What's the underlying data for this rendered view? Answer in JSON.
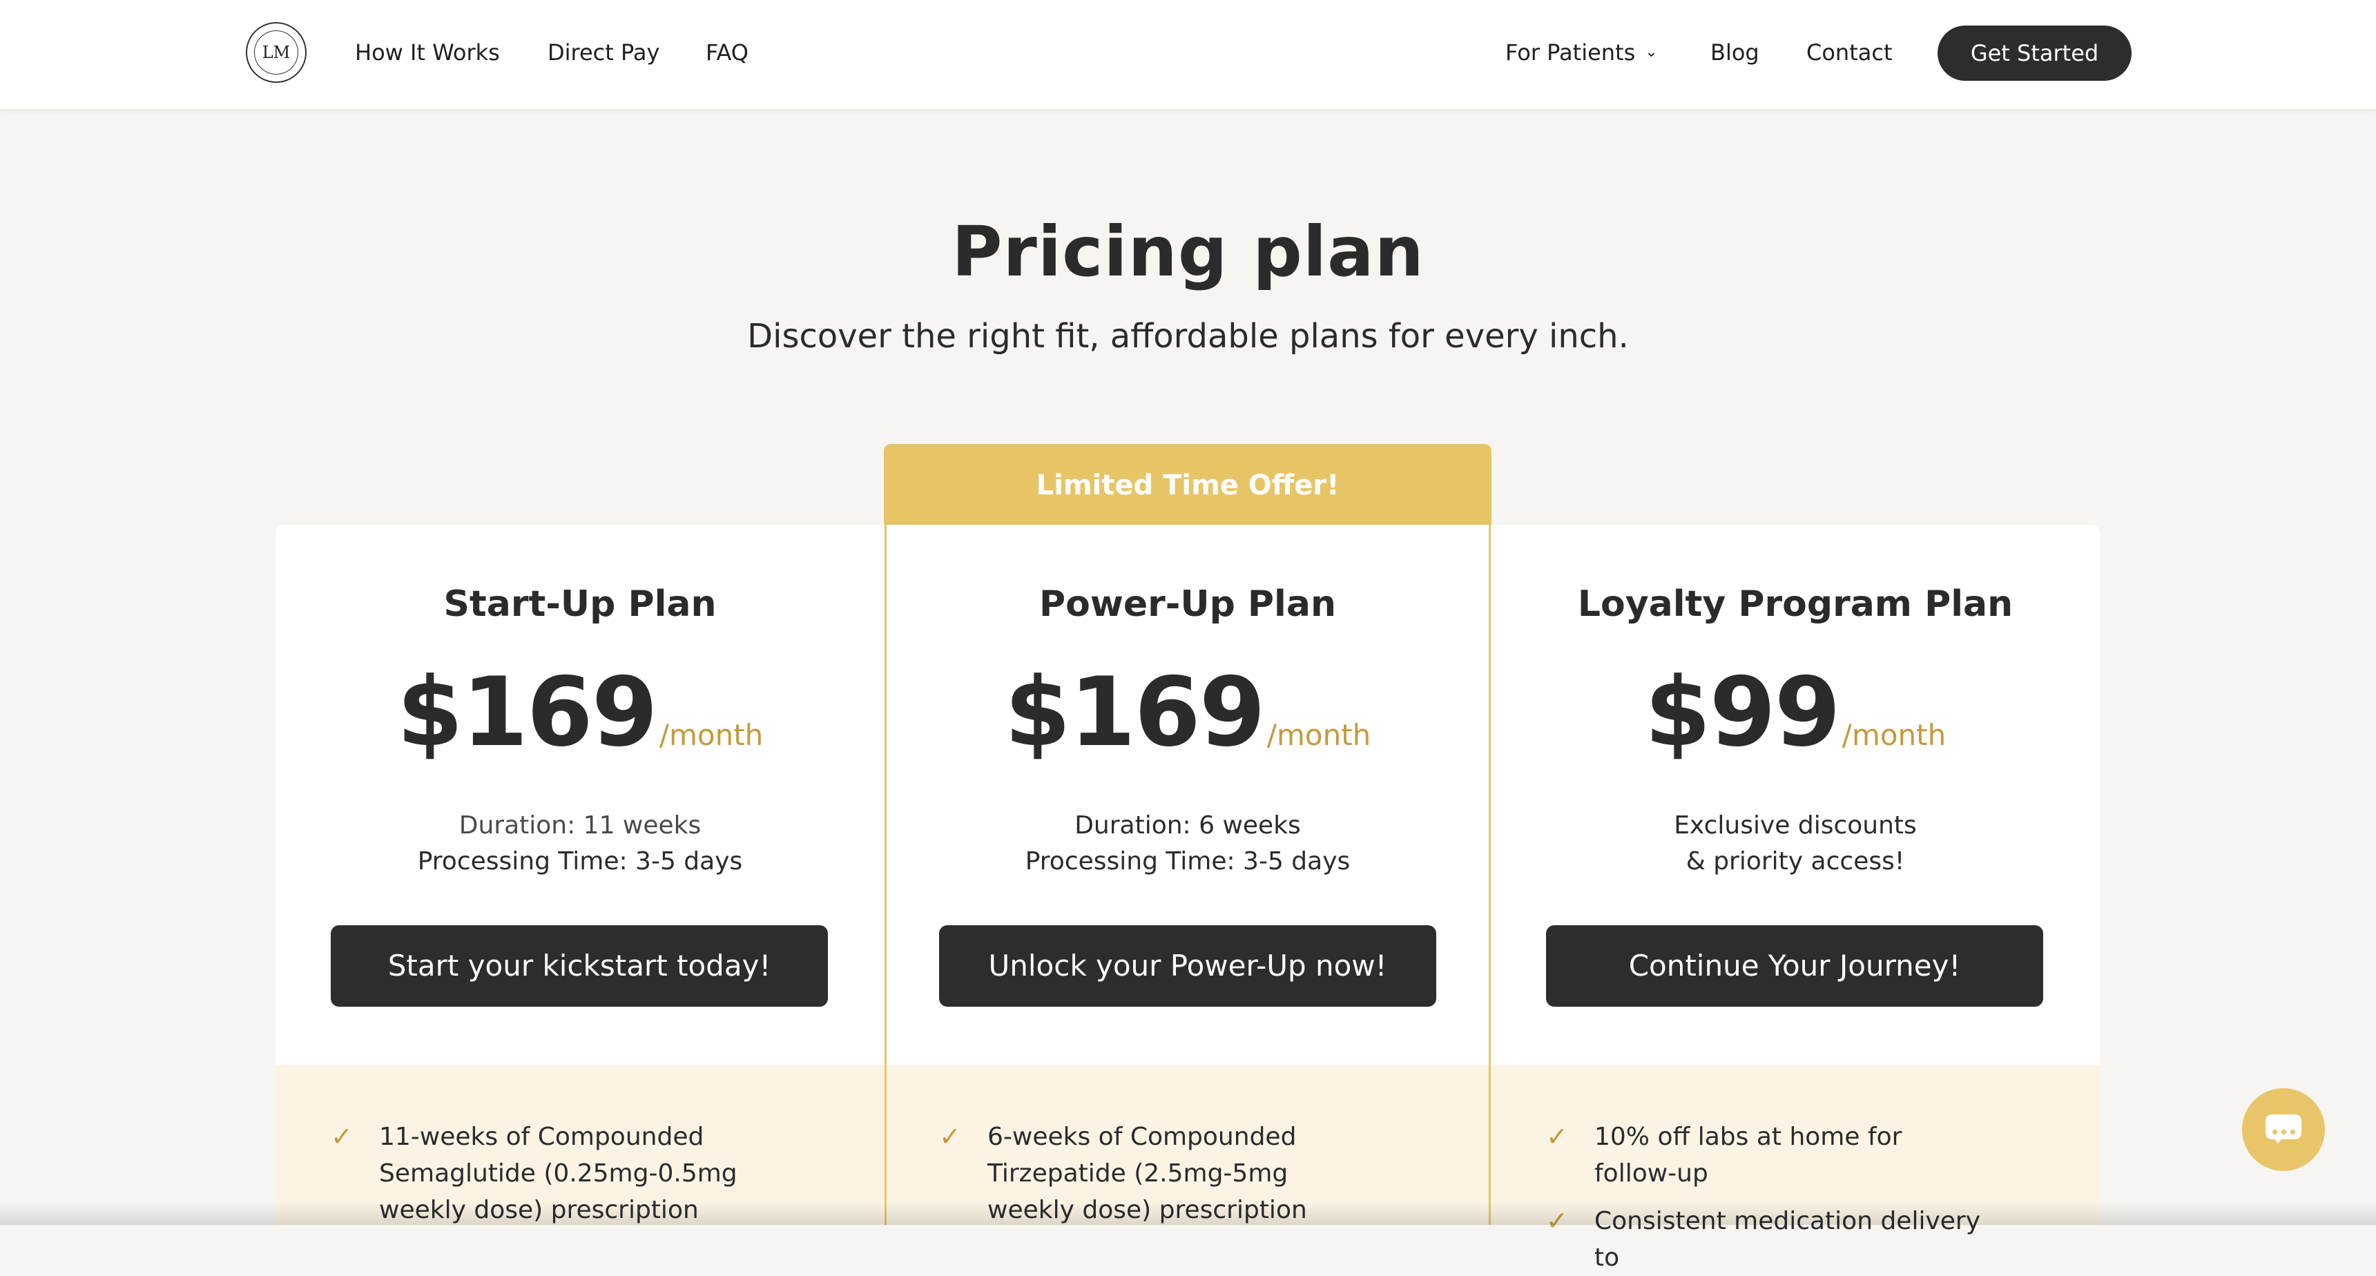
{
  "nav": {
    "logo_alt": "LM",
    "links_left": [
      {
        "label": "How It Works"
      },
      {
        "label": "Direct Pay"
      },
      {
        "label": "FAQ"
      }
    ],
    "for_patients": "For Patients",
    "blog": "Blog",
    "contact": "Contact",
    "cta": "Get Started"
  },
  "hero": {
    "title": "Pricing plan",
    "subtitle": "Discover the right fit, affordable plans for every inch."
  },
  "plans": [
    {
      "name": "Start-Up Plan",
      "price": "$169",
      "period": "/month",
      "line1": "Duration: 11 weeks",
      "line2": "Processing Time: 3-5 days",
      "button": "Start your kickstart today!",
      "features": [
        "11-weeks of Compounded Semaglutide (0.25mg-0.5mg weekly dose) prescription"
      ]
    },
    {
      "badge": "Limited Time Offer!",
      "name": "Power-Up Plan",
      "price": "$169",
      "period": "/month",
      "line1": "Duration: 6 weeks",
      "line2": "Processing Time: 3-5 days",
      "button": "Unlock your Power-Up now!",
      "features": [
        "6-weeks of Compounded Tirzepatide (2.5mg-5mg weekly dose) prescription"
      ]
    },
    {
      "name": "Loyalty Program Plan",
      "price": "$99",
      "period": "/month",
      "line1": "Exclusive discounts",
      "line2": "& priority access!",
      "button": "Continue Your Journey!",
      "features": [
        "10% off labs at home for follow-up",
        "Consistent medication delivery to"
      ]
    }
  ],
  "icons": {
    "check": "check-icon",
    "chevron": "chevron-down-icon",
    "chat": "chat-icon"
  },
  "colors": {
    "accent": "#e7c567",
    "price_period": "#c59a3d",
    "dark_button": "#2d2d2d",
    "page_bg": "#f6f5f1",
    "feature_bg": "#fbf4e5"
  }
}
